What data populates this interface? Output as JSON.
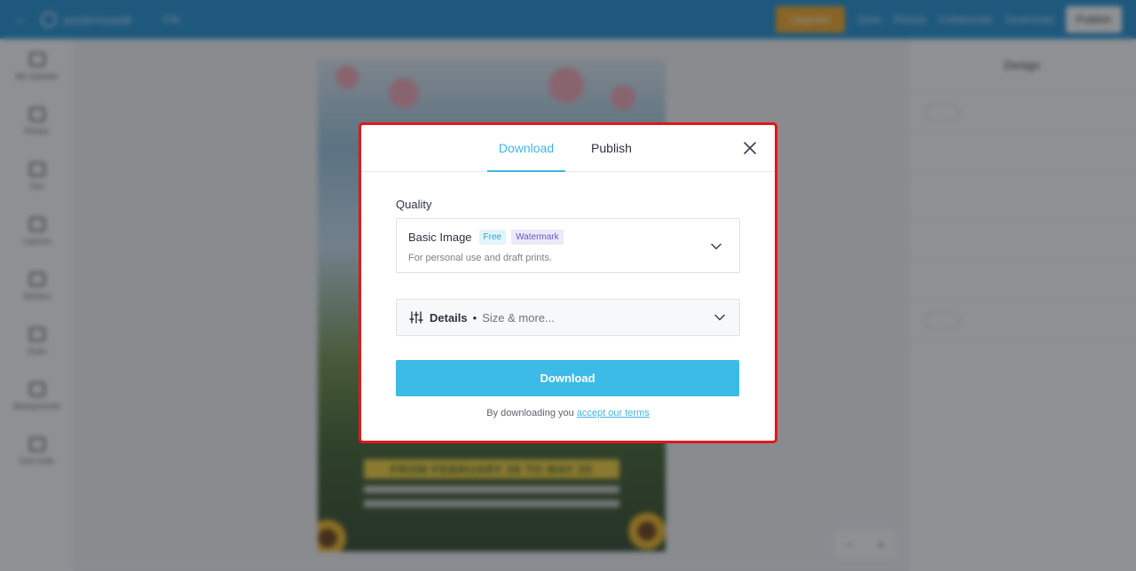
{
  "editor": {
    "brand": "postermywall",
    "file_menu": "File",
    "actions": [
      "Upgrade",
      "Save",
      "Resize",
      "Collaborate",
      "Download"
    ],
    "publish_label": "Publish",
    "left_tools": [
      "My Uploads",
      "Photos",
      "Text",
      "Layouts",
      "Stickers",
      "Draw",
      "Backgrounds",
      "Grid Cells"
    ],
    "right_panel_title": "Design",
    "banner_text": "FROM FEBRUARY 28 TO MAY 25"
  },
  "modal": {
    "tabs": [
      {
        "label": "Download",
        "active": true
      },
      {
        "label": "Publish",
        "active": false
      }
    ],
    "quality": {
      "label": "Quality",
      "selected_name": "Basic Image",
      "badge_free": "Free",
      "badge_watermark": "Watermark",
      "description": "For personal use and draft prints."
    },
    "details": {
      "title": "Details",
      "separator": "•",
      "subtitle": "Size & more..."
    },
    "download_button": "Download",
    "terms_prefix": "By downloading you",
    "terms_link": "accept our terms"
  },
  "colors": {
    "accent": "#3dbbe7",
    "highlight_border": "#e4161b",
    "topbar": "#1f8fd2"
  }
}
